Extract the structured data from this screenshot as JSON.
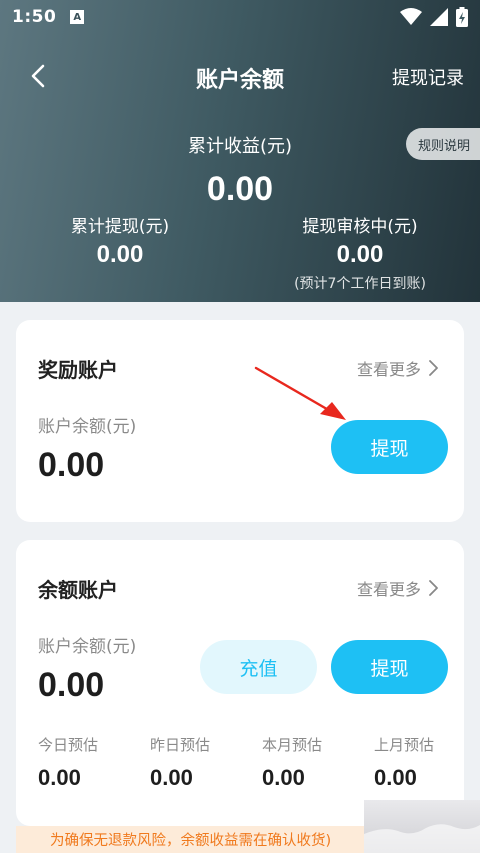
{
  "status_bar": {
    "time": "1:50",
    "app_icon_letter": "A",
    "icons": [
      "wifi-icon",
      "signal-icon",
      "battery-charging-icon"
    ]
  },
  "nav": {
    "title": "账户余额",
    "record_link": "提现记录",
    "back_icon": "chevron-left-icon"
  },
  "summary": {
    "rules_button": "规则说明",
    "total_label": "累计收益(元)",
    "total_value": "0.00",
    "withdrawn_label": "累计提现(元)",
    "withdrawn_value": "0.00",
    "pending_label": "提现审核中(元)",
    "pending_value": "0.00",
    "pending_note": "(预计7个工作日到账)"
  },
  "reward_account": {
    "title": "奖励账户",
    "more_link": "查看更多",
    "balance_label": "账户余额(元)",
    "balance_value": "0.00",
    "withdraw_button": "提现"
  },
  "balance_account": {
    "title": "余额账户",
    "more_link": "查看更多",
    "balance_label": "账户余额(元)",
    "balance_value": "0.00",
    "recharge_button": "充值",
    "withdraw_button": "提现",
    "estimates": [
      {
        "label": "今日预估",
        "value": "0.00"
      },
      {
        "label": "昨日预估",
        "value": "0.00"
      },
      {
        "label": "本月预估",
        "value": "0.00"
      },
      {
        "label": "上月预估",
        "value": "0.00"
      }
    ]
  },
  "notice": {
    "text": "为确保无退款风险，余额收益需在确认收货)"
  },
  "colors": {
    "accent": "#1ec0f4",
    "accent_light": "#e2f7fd",
    "header_start": "#5d7780",
    "header_end": "#22333a",
    "notice_text": "#f07a1e",
    "notice_bg": "#fdebd9",
    "annotation_arrow": "#e8281e"
  }
}
